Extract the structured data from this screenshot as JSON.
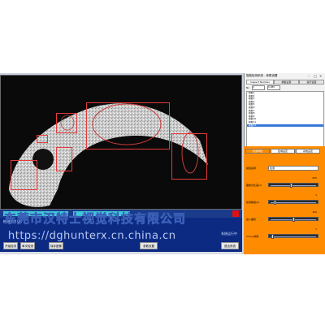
{
  "panel": {
    "title": "智能检测系统 - 参数设置",
    "tabs": [
      "Inspect Number",
      "模板设置",
      "运行设置"
    ],
    "param_label": "No",
    "param_value1": "4",
    "param_value2": "0.985",
    "list_items": [
      "模板1",
      "模板2",
      "模板3",
      "模板4",
      "模板5",
      "模板6",
      "模板7",
      "模板8",
      "模板9",
      "模板10",
      "模板11",
      "模板12"
    ],
    "selected_index": 11
  },
  "settings": {
    "tabs": [
      "检测参数",
      "区域设定",
      "系统设定"
    ],
    "name_label": "模板名称",
    "name_value": "检测",
    "sliders": [
      {
        "label": "图像对比度(1)",
        "value": "255",
        "level": 0.45
      },
      {
        "label": "检测精度(2)",
        "value": "1",
        "level": 0.1
      },
      {
        "label": "最小面积",
        "value": "100",
        "level": 0.5
      },
      {
        "label": "Canny阈值",
        "value": "1",
        "level": 0.05
      }
    ]
  },
  "bottom": {
    "message": "检测完成 OK",
    "status_right": "系统运行中",
    "buttons": [
      "开始检测",
      "单次检测",
      "保存图像",
      "参数设置",
      "退出系统"
    ]
  },
  "watermark": {
    "line1": "东莞市汉特士视觉科技有限公司",
    "line2": "https://dghunterx.cn.china.cn"
  },
  "colors": {
    "accent": "#ff8c00",
    "roi": "#e23b3b",
    "status": "#0d2a82"
  }
}
